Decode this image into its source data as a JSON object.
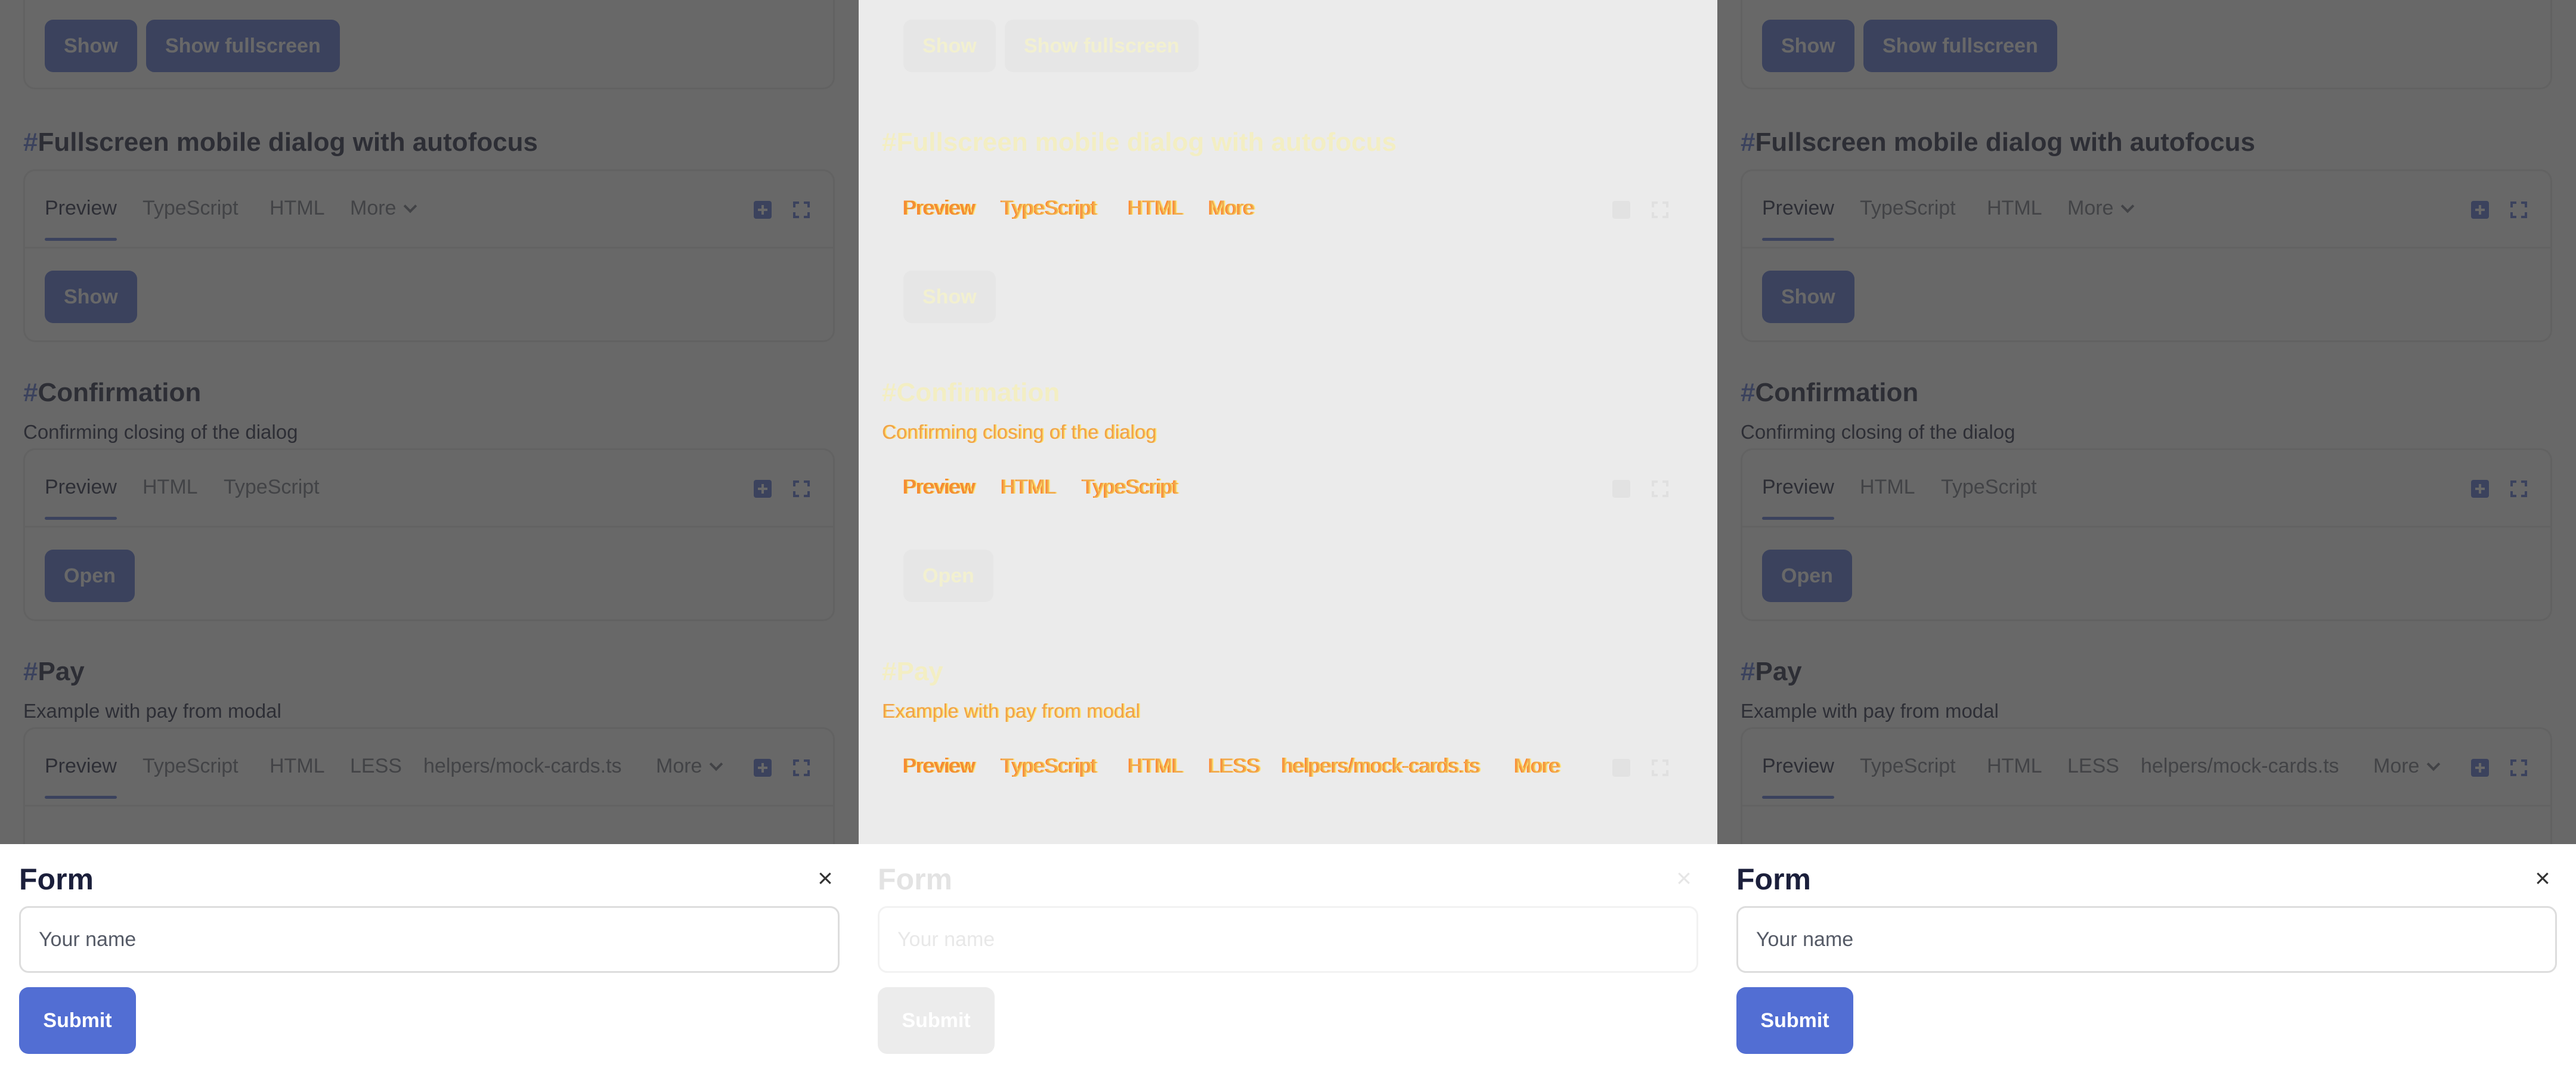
{
  "sections": {
    "fullscreen_buttons": {
      "show": "Show",
      "show_fullscreen": "Show fullscreen"
    },
    "mobile_autofocus": {
      "hash": "#",
      "title": "Fullscreen mobile dialog with autofocus",
      "tabs": [
        "Preview",
        "TypeScript",
        "HTML",
        "More"
      ],
      "button": "Show"
    },
    "confirmation": {
      "hash": "#",
      "title": "Confirmation",
      "description": "Confirming closing of the dialog",
      "tabs": [
        "Preview",
        "HTML",
        "TypeScript"
      ],
      "button": "Open"
    },
    "pay": {
      "hash": "#",
      "title": "Pay",
      "description": "Example with pay from modal",
      "tabs": [
        "Preview",
        "TypeScript",
        "HTML",
        "LESS",
        "helpers/mock-cards.ts",
        "More"
      ]
    }
  },
  "dialog": {
    "title": "Form",
    "close_symbol": "×",
    "name_placeholder": "Your name",
    "submit": "Submit"
  },
  "icons": [
    "add-square-icon",
    "expand-fullscreen-icon",
    "chevron-down-icon",
    "close-icon"
  ],
  "colors": {
    "accent": "#526ed3",
    "text": "#1b1f3b",
    "muted_text": "#6b6f7b",
    "overlay": "#333333",
    "glitch_orange": "#f08a22",
    "glitch_yellow": "#ffe36b"
  }
}
